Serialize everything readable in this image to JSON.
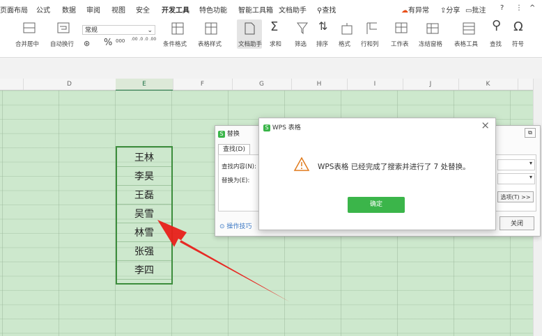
{
  "ribbon": {
    "tabs": [
      "页面布局",
      "公式",
      "数据",
      "审阅",
      "视图",
      "安全",
      "开发工具",
      "特色功能",
      "智能工具箱",
      "文档助手",
      "查找"
    ],
    "right_items": [
      "有异常",
      "分享",
      "批注",
      "?",
      "⋮",
      "^"
    ],
    "tools": [
      "合并居中",
      "自动换行",
      "常规",
      "条件格式",
      "表格样式",
      "文档助手",
      "求和",
      "筛选",
      "排序",
      "格式",
      "行和列",
      "工作表",
      "冻结窗格",
      "表格工具",
      "查找",
      "符号"
    ],
    "number_format": [
      "%",
      "000"
    ],
    "decimal": [
      ".00 .0",
      ".0 .00"
    ]
  },
  "columns": [
    "D",
    "E",
    "F",
    "G",
    "H",
    "I",
    "J",
    "K"
  ],
  "selected_column": "E",
  "cells": [
    "王林",
    "李昊",
    "王磊",
    "吴雪",
    "林雪",
    "张强",
    "李四"
  ],
  "replace_dialog": {
    "title": "替换",
    "tab_find": "查找(D)",
    "find_label": "查找内容(N):",
    "replace_label": "替换为(E):",
    "options_button": "选项(T) >>",
    "close_button": "关闭",
    "tips_link": "操作技巧"
  },
  "alert_dialog": {
    "title": "WPS 表格",
    "message": "WPS表格 已经完成了搜索并进行了 7 处替换。",
    "confirm_button": "确定",
    "close_glyph": "×"
  },
  "colors": {
    "accent_green": "#3bb54a",
    "sheet_green": "#cde8cd",
    "arrow_red": "#e8201a"
  }
}
